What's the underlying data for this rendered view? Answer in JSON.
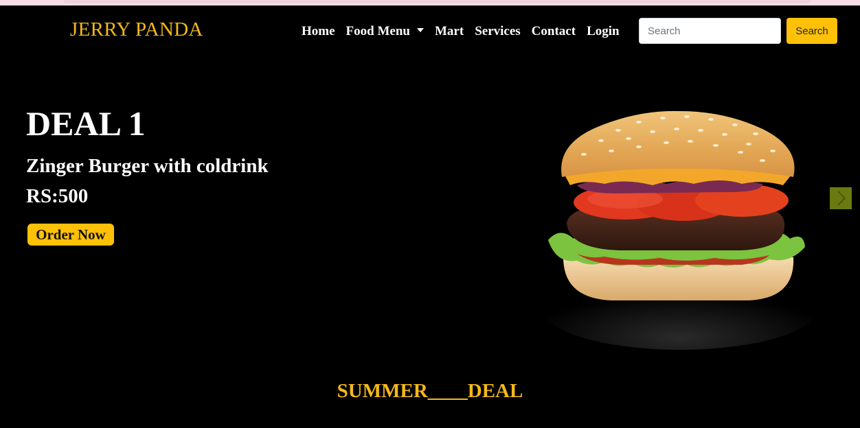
{
  "brand": "JERRY PANDA",
  "nav": {
    "home": "Home",
    "food_menu": "Food Menu",
    "mart": "Mart",
    "services": "Services",
    "contact": "Contact",
    "login": "Login"
  },
  "search": {
    "placeholder": "Search",
    "button_label": "Search"
  },
  "hero": {
    "title": "DEAL 1",
    "subtitle": "Zinger Burger with coldrink",
    "price": "RS:500",
    "order_label": "Order Now",
    "image": "burger"
  },
  "section_title": "SUMMER____DEAL",
  "colors": {
    "accent": "#ffc107",
    "brand": "#f3b919",
    "background": "#000000",
    "carousel_control": "#6b7a10"
  },
  "icons": {
    "dropdown": "caret-down-icon",
    "next": "chevron-right-icon"
  }
}
